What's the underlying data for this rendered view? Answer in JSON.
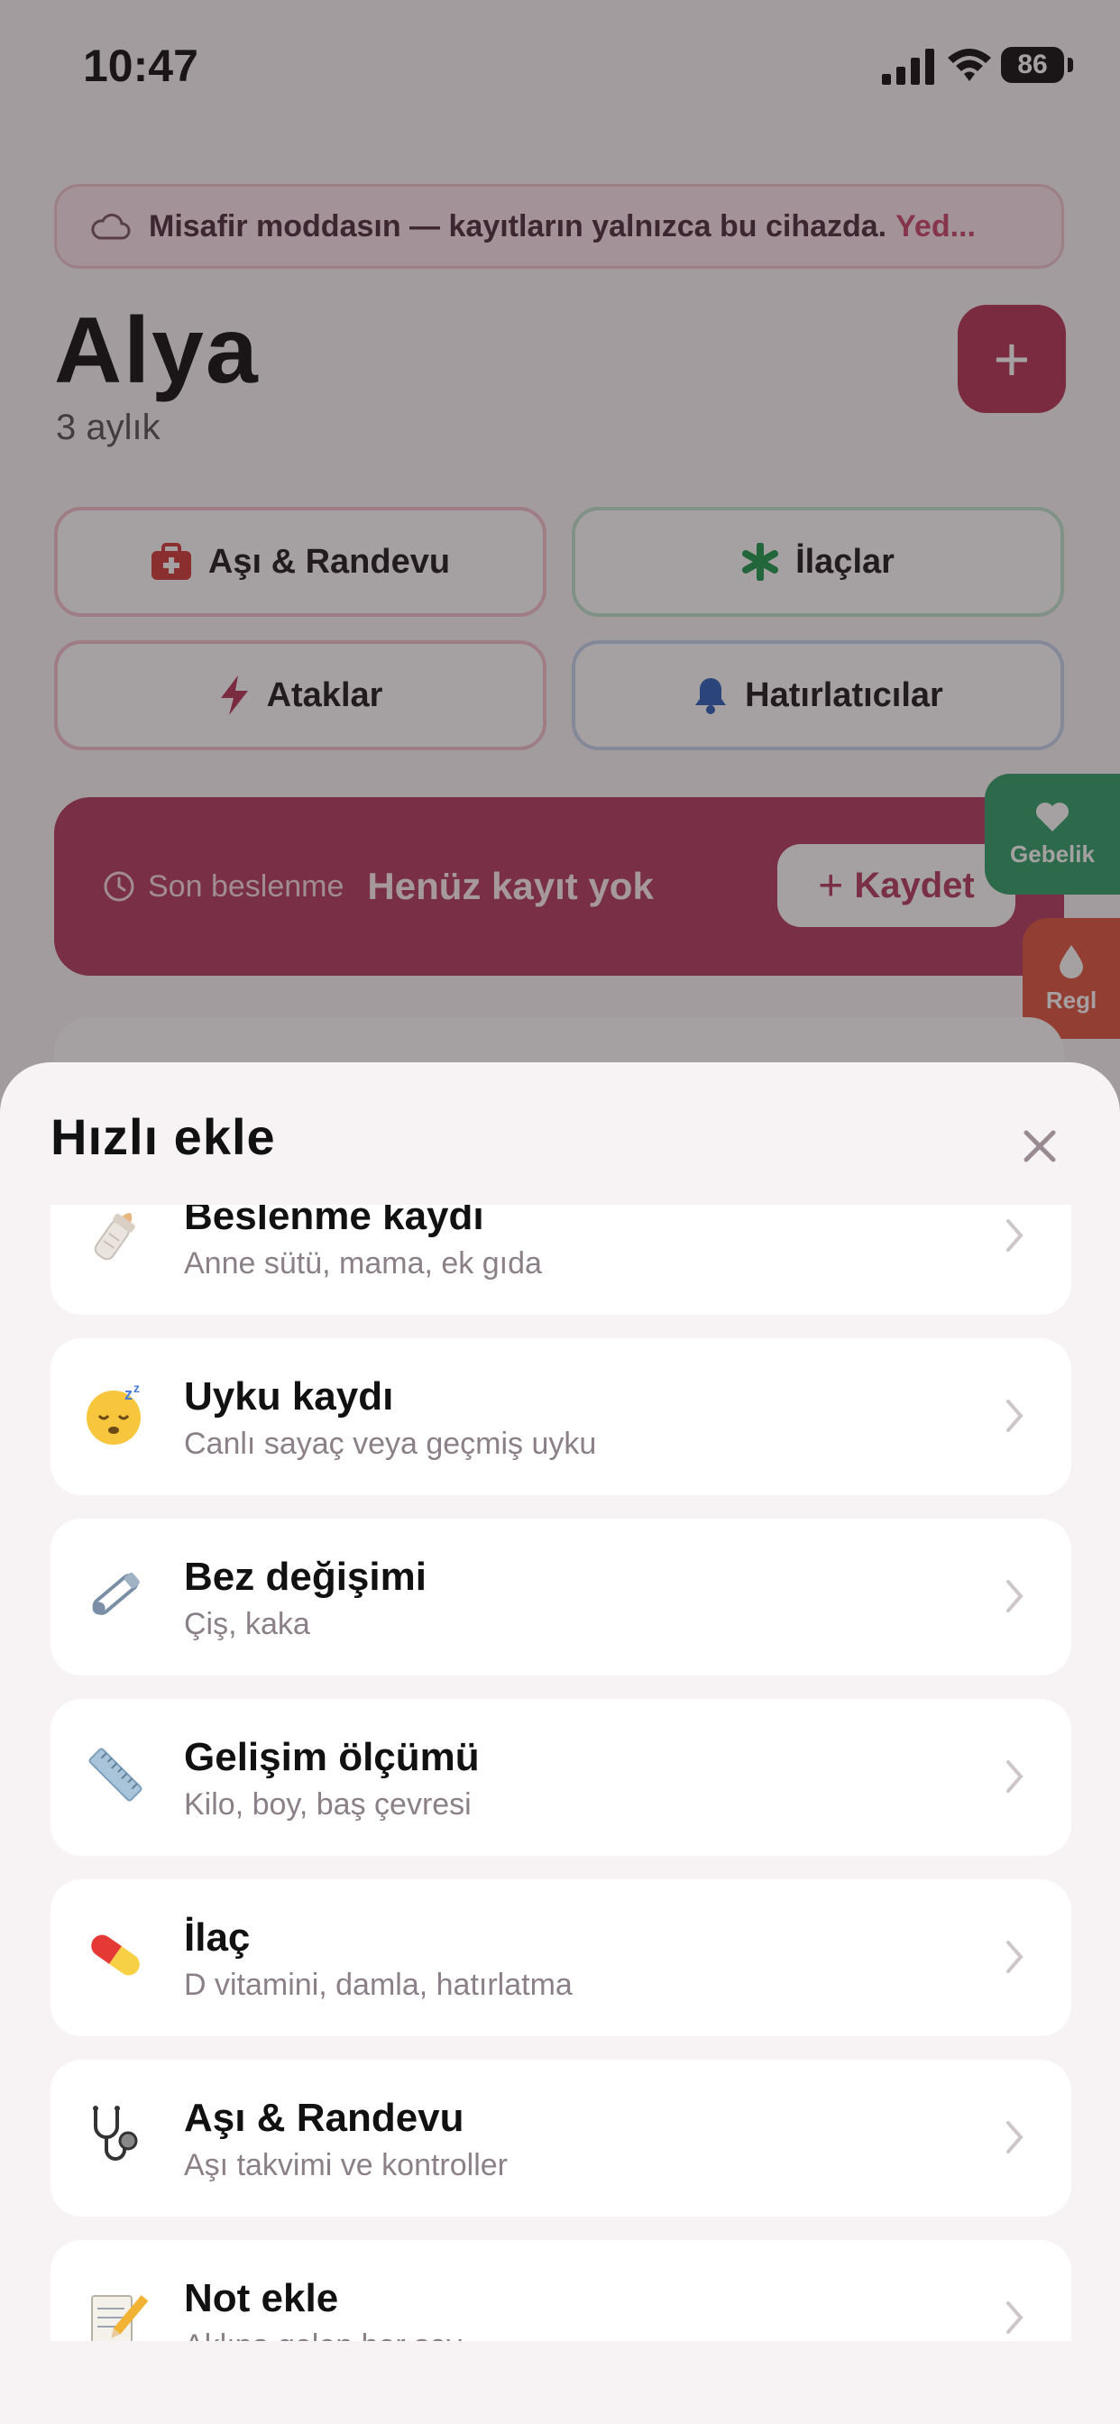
{
  "status": {
    "time": "10:47",
    "battery": "86"
  },
  "banner": {
    "text": "Misafir moddasın — kayıtların yalnızca bu cihazda.",
    "more": "Yed..."
  },
  "profile": {
    "name": "Alya",
    "age": "3 aylık",
    "add_label": "+"
  },
  "quick_actions": [
    {
      "label": "Aşı & Randevu",
      "icon": "medical-kit-icon"
    },
    {
      "label": "İlaçlar",
      "icon": "asterisk-icon"
    },
    {
      "label": "Ataklar",
      "icon": "lightning-icon"
    },
    {
      "label": "Hatırlatıcılar",
      "icon": "bell-icon"
    }
  ],
  "feeding": {
    "label": "Son beslenme",
    "value": "Henüz kayıt yok",
    "button": "Kaydet"
  },
  "side_tabs": [
    {
      "label": "Gebelik",
      "icon": "heart-icon"
    },
    {
      "label": "Regl",
      "icon": "drop-icon"
    }
  ],
  "sheet": {
    "title": "Hızlı ekle",
    "items": [
      {
        "title": "Beslenme kaydı",
        "subtitle": "Anne sütü, mama, ek gıda",
        "icon": "baby-bottle-icon"
      },
      {
        "title": "Uyku kaydı",
        "subtitle": "Canlı sayaç veya geçmiş uyku",
        "icon": "sleeping-face-icon"
      },
      {
        "title": "Bez değişimi",
        "subtitle": "Çiş, kaka",
        "icon": "safety-pin-icon"
      },
      {
        "title": "Gelişim ölçümü",
        "subtitle": "Kilo, boy, baş çevresi",
        "icon": "ruler-icon"
      },
      {
        "title": "İlaç",
        "subtitle": "D vitamini, damla, hatırlatma",
        "icon": "pill-icon"
      },
      {
        "title": "Aşı & Randevu",
        "subtitle": "Aşı takvimi ve kontroller",
        "icon": "stethoscope-icon"
      },
      {
        "title": "Not ekle",
        "subtitle": "Aklına gelen her şey",
        "icon": "memo-icon"
      }
    ]
  },
  "colors": {
    "accent": "#b53457",
    "green": "#2fa06a",
    "orange": "#e05540"
  }
}
